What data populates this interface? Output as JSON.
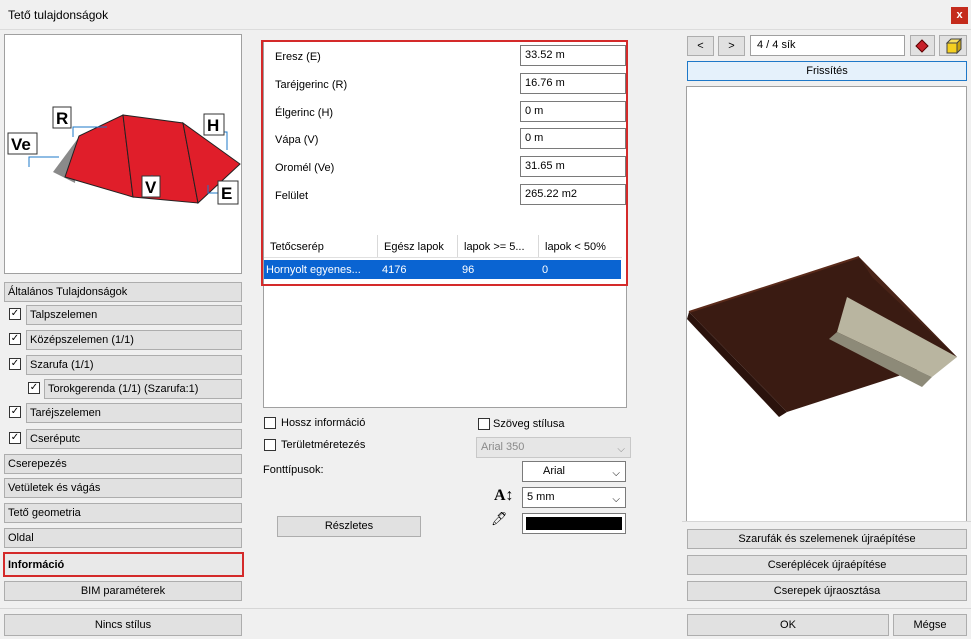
{
  "window": {
    "title": "Tető tulajdonságok",
    "close_label": "x"
  },
  "diagram": {
    "labels": {
      "ve": "Ve",
      "r": "R",
      "h": "H",
      "v": "V",
      "e": "E"
    }
  },
  "left": {
    "items": [
      {
        "label": "Általános Tulajdonságok"
      },
      {
        "label": "Talpszelemen",
        "checked": true
      },
      {
        "label": "Középszelemen (1/1)",
        "checked": true
      },
      {
        "label": "Szarufa (1/1)",
        "checked": true
      },
      {
        "label": "Torokgerenda (1/1) (Szarufa:1)",
        "checked": true
      },
      {
        "label": "Taréjszelemen",
        "checked": true
      },
      {
        "label": "Cseréputc",
        "checked": true
      },
      {
        "label": "Cserepezés"
      },
      {
        "label": "Vetületek és vágás"
      },
      {
        "label": "Tető geometria"
      },
      {
        "label": "Oldal"
      },
      {
        "label": "Információ"
      },
      {
        "label": "BIM paraméterek"
      }
    ],
    "no_style": "Nincs stílus"
  },
  "info": {
    "rows": [
      {
        "label": "Eresz (E)",
        "value": "33.52 m"
      },
      {
        "label": "Taréjgerinc (R)",
        "value": "16.76 m"
      },
      {
        "label": "Élgerinc (H)",
        "value": "0 m"
      },
      {
        "label": "Vápa (V)",
        "value": "0 m"
      },
      {
        "label": "Oromél (Ve)",
        "value": "31.65 m"
      },
      {
        "label": "Felület",
        "value": "265.22 m2"
      }
    ],
    "table": {
      "headers": [
        "Tetőcserép",
        "Egész lapok",
        "lapok >= 5...",
        "lapok < 50%"
      ],
      "rows": [
        [
          "Hornyolt egyenes...",
          "4176",
          "96",
          "0"
        ]
      ]
    }
  },
  "options": {
    "hossz": "Hossz információ",
    "terulet": "Területméretezés",
    "szoveg": "Szöveg stílusa",
    "text_style_value": "Arial 350",
    "font_types": "Fonttípusok:",
    "font": "Arial",
    "size": "5 mm",
    "details": "Részletes"
  },
  "right": {
    "prev": "<",
    "next": ">",
    "page": "4 / 4 sík",
    "refresh": "Frissítés",
    "rebuild1": "Szarufák és szelemenek újraépítése",
    "rebuild2": "Cseréplécek újraépítése",
    "rebuild3": "Cserepek újraosztása",
    "ok": "OK",
    "cancel": "Mégse"
  }
}
